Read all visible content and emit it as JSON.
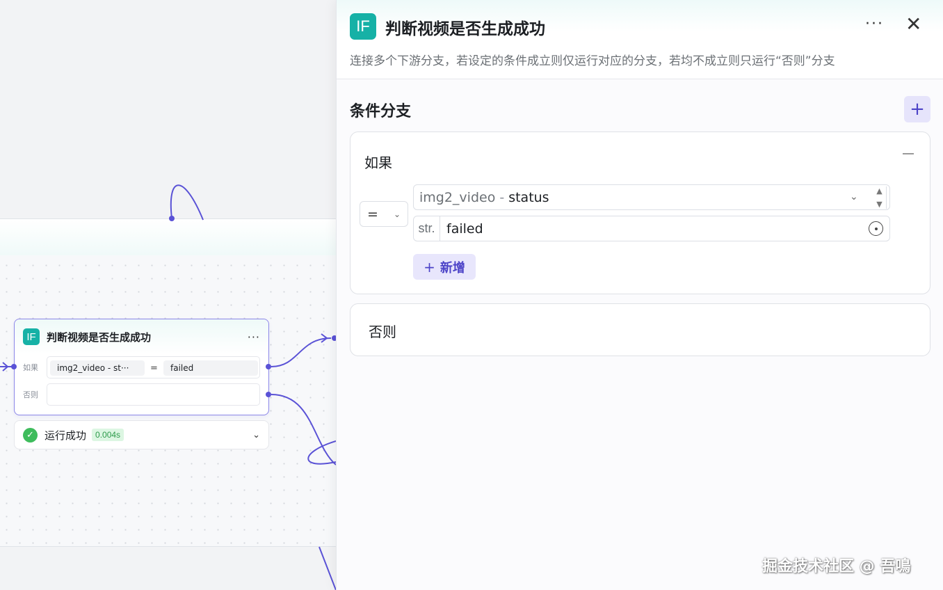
{
  "canvas": {
    "node": {
      "icon_text": "IF",
      "title": "判断视频是否生成成功",
      "more": "···",
      "if_label": "如果",
      "else_label": "否则",
      "condition": {
        "left": "img2_video  -  st···",
        "operator": "=",
        "right": "failed"
      }
    },
    "run_status": {
      "text": "运行成功",
      "duration": "0.004s",
      "chevron": "⌄"
    }
  },
  "panel": {
    "icon_text": "IF",
    "title": "判断视频是否生成成功",
    "more": "···",
    "close": "✕",
    "description": "连接多个下游分支，若设定的条件成立则仅运行对应的分支，若均不成立则只运行“否则”分支",
    "section_title": "条件分支",
    "add_branch": "+",
    "if_branch": {
      "label": "如果",
      "operator": "=",
      "variable_source": "img2_video",
      "variable_sep": "-",
      "variable_name": "status",
      "value_type": "str.",
      "value": "failed",
      "add_condition_label": "新增",
      "add_condition_plus": "+"
    },
    "else_branch": {
      "label": "否则"
    }
  },
  "watermark": "掘金技术社区 @ 吾鳴",
  "colors": {
    "accent": "#5a52d6",
    "icon_teal": "#16b1a6",
    "success": "#3ebc5c"
  }
}
